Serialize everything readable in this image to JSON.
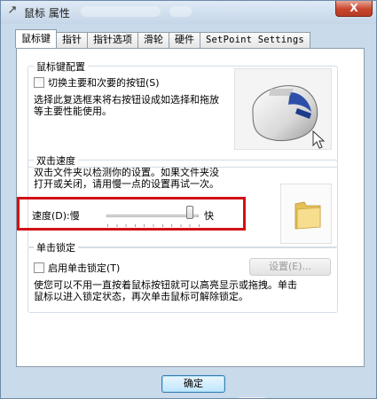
{
  "window": {
    "title": "鼠标 属性",
    "close_label": "X"
  },
  "tabs": [
    {
      "label": "鼠标键",
      "active": true
    },
    {
      "label": "指针",
      "active": false
    },
    {
      "label": "指针选项",
      "active": false
    },
    {
      "label": "滑轮",
      "active": false
    },
    {
      "label": "硬件",
      "active": false
    },
    {
      "label": "SetPoint Settings",
      "active": false
    }
  ],
  "button_config": {
    "title": "鼠标键配置",
    "checkbox_label": "切换主要和次要的按钮(S)",
    "checked": false,
    "description_line1": "选择此复选框来将右按钮设成如选择和拖放",
    "description_line2": "等主要性能使用。"
  },
  "double_click": {
    "title": "双击速度",
    "description_line1": "双击文件夹以检测你的设置。如果文件夹没",
    "description_line2": "打开或关闭，请用慢一点的设置再试一次。",
    "speed_label": "速度(D):慢",
    "fast_label": "快",
    "speed_value": 0.9
  },
  "click_lock": {
    "title": "单击锁定",
    "checkbox_label": "启用单击锁定(T)",
    "checked": false,
    "settings_button": "设置(E)...",
    "description_line1": "使您可以不用一直按着鼠标按钮就可以高亮显示或拖拽。单击",
    "description_line2": "鼠标以进入锁定状态，再次单击鼠标可解除锁定。"
  },
  "footer": {
    "ok_label": "确定"
  },
  "colors": {
    "highlight": "#d21016",
    "ok_border": "#3c7fb1"
  }
}
